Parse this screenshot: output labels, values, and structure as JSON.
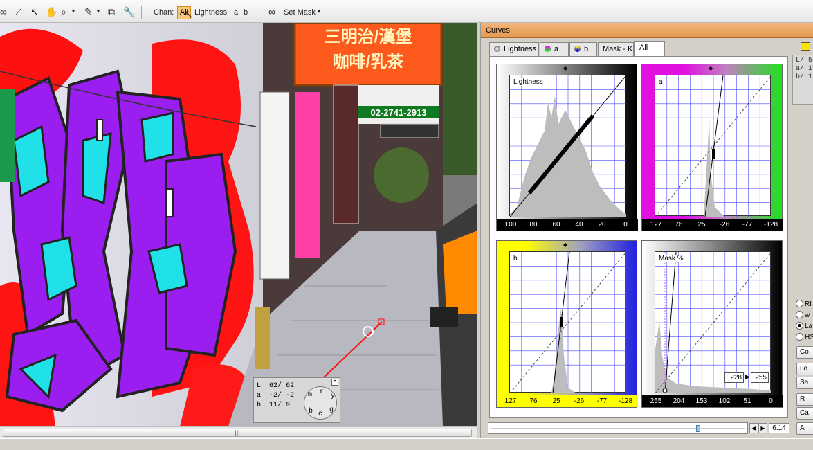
{
  "toolbar": {
    "chan_label": "Chan:",
    "channels": [
      "All",
      "Lightness",
      "a",
      "b"
    ],
    "set_mask_label": "Set Mask"
  },
  "readout": {
    "rows": [
      {
        "ch": "L",
        "v1": "62/",
        "v2": "62"
      },
      {
        "ch": "a",
        "v1": "-2/",
        "v2": "-2"
      },
      {
        "ch": "b",
        "v1": "11/",
        "v2": "9"
      }
    ],
    "dial_letters": [
      "m",
      "r",
      "y",
      "b",
      "c",
      "g"
    ]
  },
  "sign_text": {
    "top_line1": "三明治/漢堡",
    "top_line2": "咖啡/乳茶",
    "phone": "02-2741-2913"
  },
  "curves": {
    "title": "Curves",
    "tabs": [
      "Lightness",
      "a",
      "b",
      "Mask - K",
      "All"
    ],
    "active_tab": "All",
    "graphs": [
      {
        "label": "Lightness",
        "ticks": [
          "100",
          "80",
          "60",
          "40",
          "20",
          "0"
        ]
      },
      {
        "label": "a",
        "ticks": [
          "127",
          "76",
          "25",
          "-26",
          "-77",
          "-128"
        ]
      },
      {
        "label": "b",
        "ticks": [
          "127",
          "76",
          "25",
          "-26",
          "-77",
          "-128"
        ]
      },
      {
        "label": "Mask %",
        "ticks": [
          "255",
          "204",
          "153",
          "102",
          "51",
          "0"
        ]
      }
    ],
    "mask_field_in": "228",
    "mask_field_out": "255",
    "mini_readout": [
      "L/ 5",
      "a/ 1",
      "b/ 1"
    ],
    "radios": [
      {
        "label": "RI",
        "checked": false
      },
      {
        "label": "w",
        "checked": false
      },
      {
        "label": "La",
        "checked": true
      },
      {
        "label": "HS",
        "checked": false
      }
    ],
    "buttons": [
      "Co",
      "Lo",
      "Sa",
      "R",
      "Ca",
      "A"
    ],
    "zoom_value": "6.14",
    "slider_fraction": 0.82
  },
  "colors": {
    "title_bar": "#e9a25e",
    "graph_grid": "#4a4aff",
    "accent": "#f7c77a"
  }
}
